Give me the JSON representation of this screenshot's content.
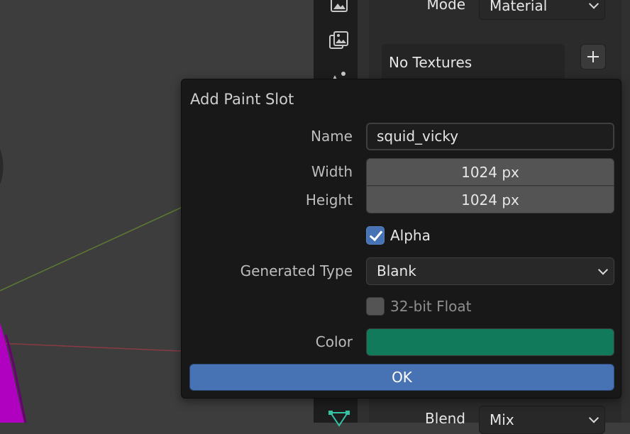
{
  "properties": {
    "mode_label": "Mode",
    "mode_value": "Material",
    "textures_empty": "No Textures",
    "blend_label": "Blend",
    "blend_value": "Mix"
  },
  "dialog": {
    "title": "Add Paint Slot",
    "name_label": "Name",
    "name_value": "squid_vicky",
    "width_label": "Width",
    "width_value": "1024 px",
    "height_label": "Height",
    "height_value": "1024 px",
    "alpha_label": "Alpha",
    "alpha_checked": true,
    "generated_type_label": "Generated Type",
    "generated_type_value": "Blank",
    "float_label": "32-bit Float",
    "float_checked": false,
    "color_label": "Color",
    "color_value": "#107a5a",
    "ok_label": "OK"
  },
  "colors": {
    "accent": "#4772b3",
    "mesh_magenta": "#b000c0",
    "x_axis": "#8a3a44",
    "y_axis": "#5e7a32",
    "tool_green": "#35c3a6"
  },
  "icons": [
    "image-paint-icon",
    "texture-stack-icon",
    "particles-icon",
    "vertex-edit-icon",
    "plus-icon",
    "chevron-down-icon",
    "checkmark-icon"
  ]
}
